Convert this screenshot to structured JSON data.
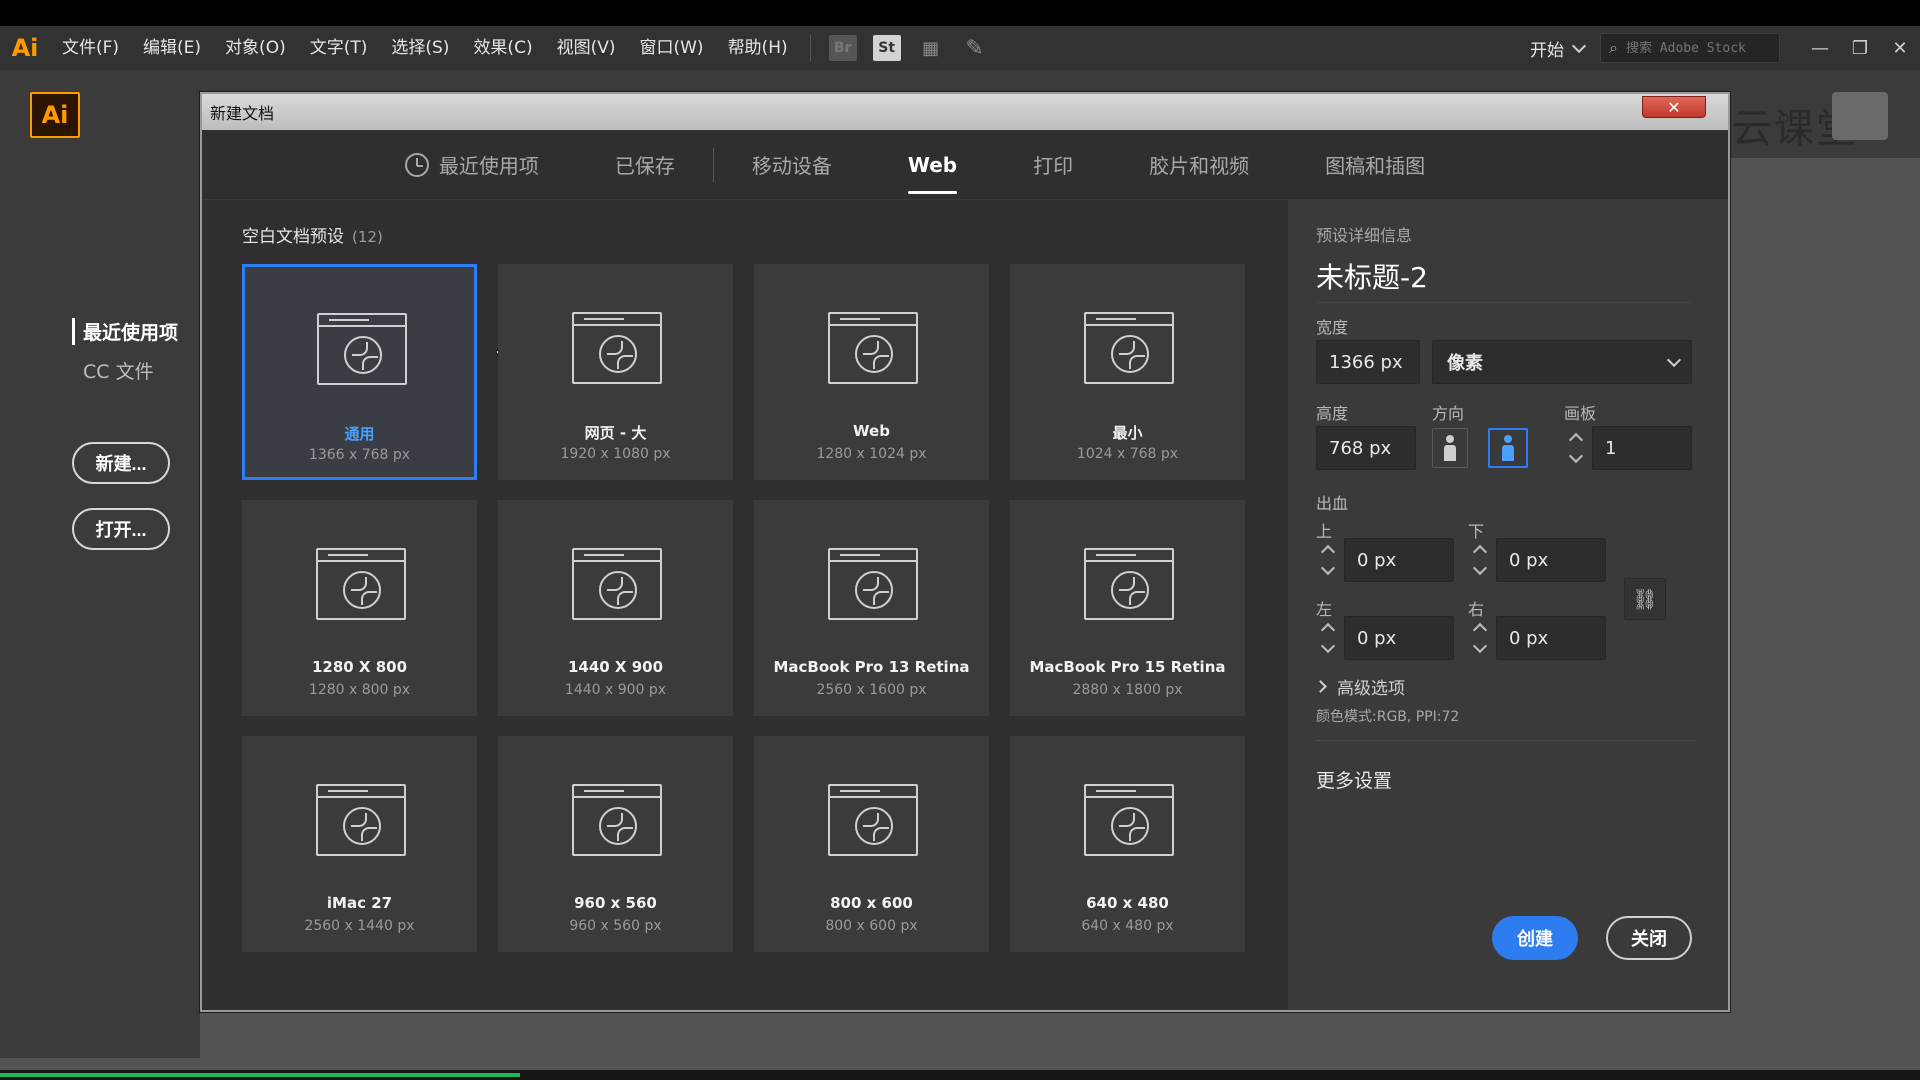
{
  "menubar": {
    "app_glyph": "Ai",
    "items": [
      "文件(F)",
      "编辑(E)",
      "对象(O)",
      "文字(T)",
      "选择(S)",
      "效果(C)",
      "视图(V)",
      "窗口(W)",
      "帮助(H)"
    ],
    "bridge_label": "Br",
    "stock_label": "St",
    "workspace": "开始",
    "search_placeholder": "搜索 Adobe Stock"
  },
  "start": {
    "logo": "Ai",
    "recent": "最近使用项",
    "cc_files": "CC 文件",
    "new_button": "新建...",
    "open_button": "打开...",
    "watermark": "网易云课堂"
  },
  "dialog": {
    "title": "新建文档",
    "close_glyph": "✕",
    "tabs": {
      "recent": "最近使用项",
      "saved": "已保存",
      "mobile": "移动设备",
      "web": "Web",
      "print": "打印",
      "film": "胶片和视频",
      "art": "图稿和插图"
    },
    "presets_label": "空白文档预设",
    "presets_count": "(12)",
    "presets": [
      {
        "name": "通用",
        "size": "1366 x 768 px"
      },
      {
        "name": "网页 - 大",
        "size": "1920 x 1080 px"
      },
      {
        "name": "Web",
        "size": "1280 x 1024 px"
      },
      {
        "name": "最小",
        "size": "1024 x 768 px"
      },
      {
        "name": "1280 X 800",
        "size": "1280 x 800 px"
      },
      {
        "name": "1440 X 900",
        "size": "1440 x 900 px"
      },
      {
        "name": "MacBook Pro 13 Retina",
        "size": "2560 x 1600 px"
      },
      {
        "name": "MacBook Pro 15 Retina",
        "size": "2880 x 1800 px"
      },
      {
        "name": "iMac 27",
        "size": "2560 x 1440 px"
      },
      {
        "name": "960 x 560",
        "size": "960 x 560 px"
      },
      {
        "name": "800 x 600",
        "size": "800 x 600 px"
      },
      {
        "name": "640 x 480",
        "size": "640 x 480 px"
      }
    ],
    "details": {
      "heading": "预设详细信息",
      "doc_name": "未标题-2",
      "width_label": "宽度",
      "width_value": "1366 px",
      "unit": "像素",
      "height_label": "高度",
      "height_value": "768 px",
      "orientation_label": "方向",
      "artboard_label": "画板",
      "artboard_value": "1",
      "bleed_label": "出血",
      "top_label": "上",
      "top_value": "0 px",
      "bottom_label": "下",
      "bottom_value": "0 px",
      "left_label": "左",
      "left_value": "0 px",
      "right_label": "右",
      "right_value": "0 px",
      "advanced": "高级选项",
      "color_mode": "颜色模式:RGB, PPI:72",
      "more_settings": "更多设置",
      "create": "创建",
      "close": "关闭"
    }
  },
  "colors": {
    "accent": "#2e7cf6",
    "selected_text": "#4aa0ff",
    "brand": "#ff9a00"
  }
}
